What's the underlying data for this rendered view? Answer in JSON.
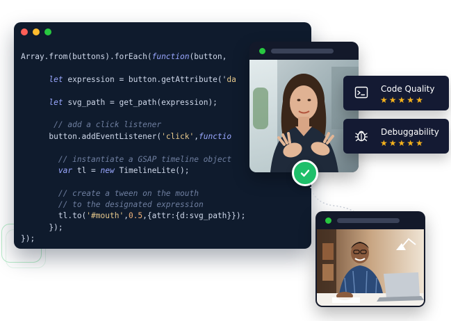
{
  "code_editor": {
    "lines": [
      [
        [
          "plain",
          "Array.from(buttons).forEach("
        ],
        [
          "kw",
          "function"
        ],
        [
          "plain",
          "(button, "
        ]
      ],
      [],
      [
        [
          "plain",
          "      "
        ],
        [
          "kw",
          "let"
        ],
        [
          "plain",
          " expression = button.getAttribute('"
        ],
        [
          "str",
          "da"
        ]
      ],
      [],
      [
        [
          "plain",
          "      "
        ],
        [
          "kw",
          "let"
        ],
        [
          "plain",
          " svg_path = get_path(expression);"
        ]
      ],
      [],
      [
        [
          "com",
          "       // add a click listener"
        ]
      ],
      [
        [
          "plain",
          "      button.addEventListener("
        ],
        [
          "str",
          "'click'"
        ],
        [
          "plain",
          ","
        ],
        [
          "kw",
          "functio"
        ]
      ],
      [],
      [
        [
          "com",
          "        // instantiate a GSAP timeline object"
        ]
      ],
      [
        [
          "plain",
          "        "
        ],
        [
          "kw",
          "var"
        ],
        [
          "plain",
          " tl = "
        ],
        [
          "kw",
          "new"
        ],
        [
          "plain",
          " TimelineLite();"
        ]
      ],
      [],
      [
        [
          "com",
          "        // create a tween on the mouth"
        ]
      ],
      [
        [
          "com",
          "        // to the designated expression"
        ]
      ],
      [
        [
          "plain",
          "        tl.to("
        ],
        [
          "str",
          "'#mouth'"
        ],
        [
          "plain",
          ","
        ],
        [
          "num",
          "0.5"
        ],
        [
          "plain",
          ",{attr:{d:svg_path}});"
        ]
      ],
      [
        [
          "plain",
          "      });"
        ]
      ],
      [
        [
          "plain",
          "});"
        ]
      ]
    ]
  },
  "rating_cards": [
    {
      "title": "Code Quality",
      "icon": "terminal-icon",
      "stars": 5
    },
    {
      "title": "Debuggability",
      "icon": "bug-icon",
      "stars": 5
    }
  ],
  "colors": {
    "accent_green": "#1fbf6a",
    "star": "#f5b21c",
    "editor_bg": "#0f1b2d",
    "card_bg": "#141a33"
  }
}
